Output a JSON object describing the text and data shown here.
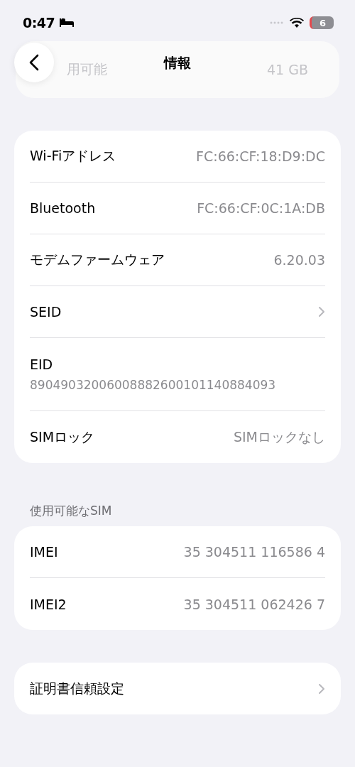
{
  "status_bar": {
    "time": "0:47",
    "battery": "6"
  },
  "nav": {
    "title": "情報"
  },
  "behind_row": {
    "label": "用可能",
    "value": "41 GB"
  },
  "groups": [
    {
      "rows": [
        {
          "kind": "value",
          "label": "Wi-Fiアドレス",
          "value": "FC:66:CF:18:D9:DC"
        },
        {
          "kind": "value",
          "label": "Bluetooth",
          "value": "FC:66:CF:0C:1A:DB"
        },
        {
          "kind": "value",
          "label": "モデムファームウェア",
          "value": "6.20.03"
        },
        {
          "kind": "link",
          "label": "SEID"
        },
        {
          "kind": "stacked",
          "label": "EID",
          "value": "89049032006008882600101140884093"
        },
        {
          "kind": "value",
          "label": "SIMロック",
          "value": "SIMロックなし"
        }
      ]
    },
    {
      "header": "使用可能なSIM",
      "rows": [
        {
          "kind": "value",
          "label": "IMEI",
          "value": "35 304511 116586 4"
        },
        {
          "kind": "value",
          "label": "IMEI2",
          "value": "35 304511 062426 7"
        }
      ]
    },
    {
      "rows": [
        {
          "kind": "link",
          "label": "証明書信頼設定"
        }
      ]
    }
  ]
}
